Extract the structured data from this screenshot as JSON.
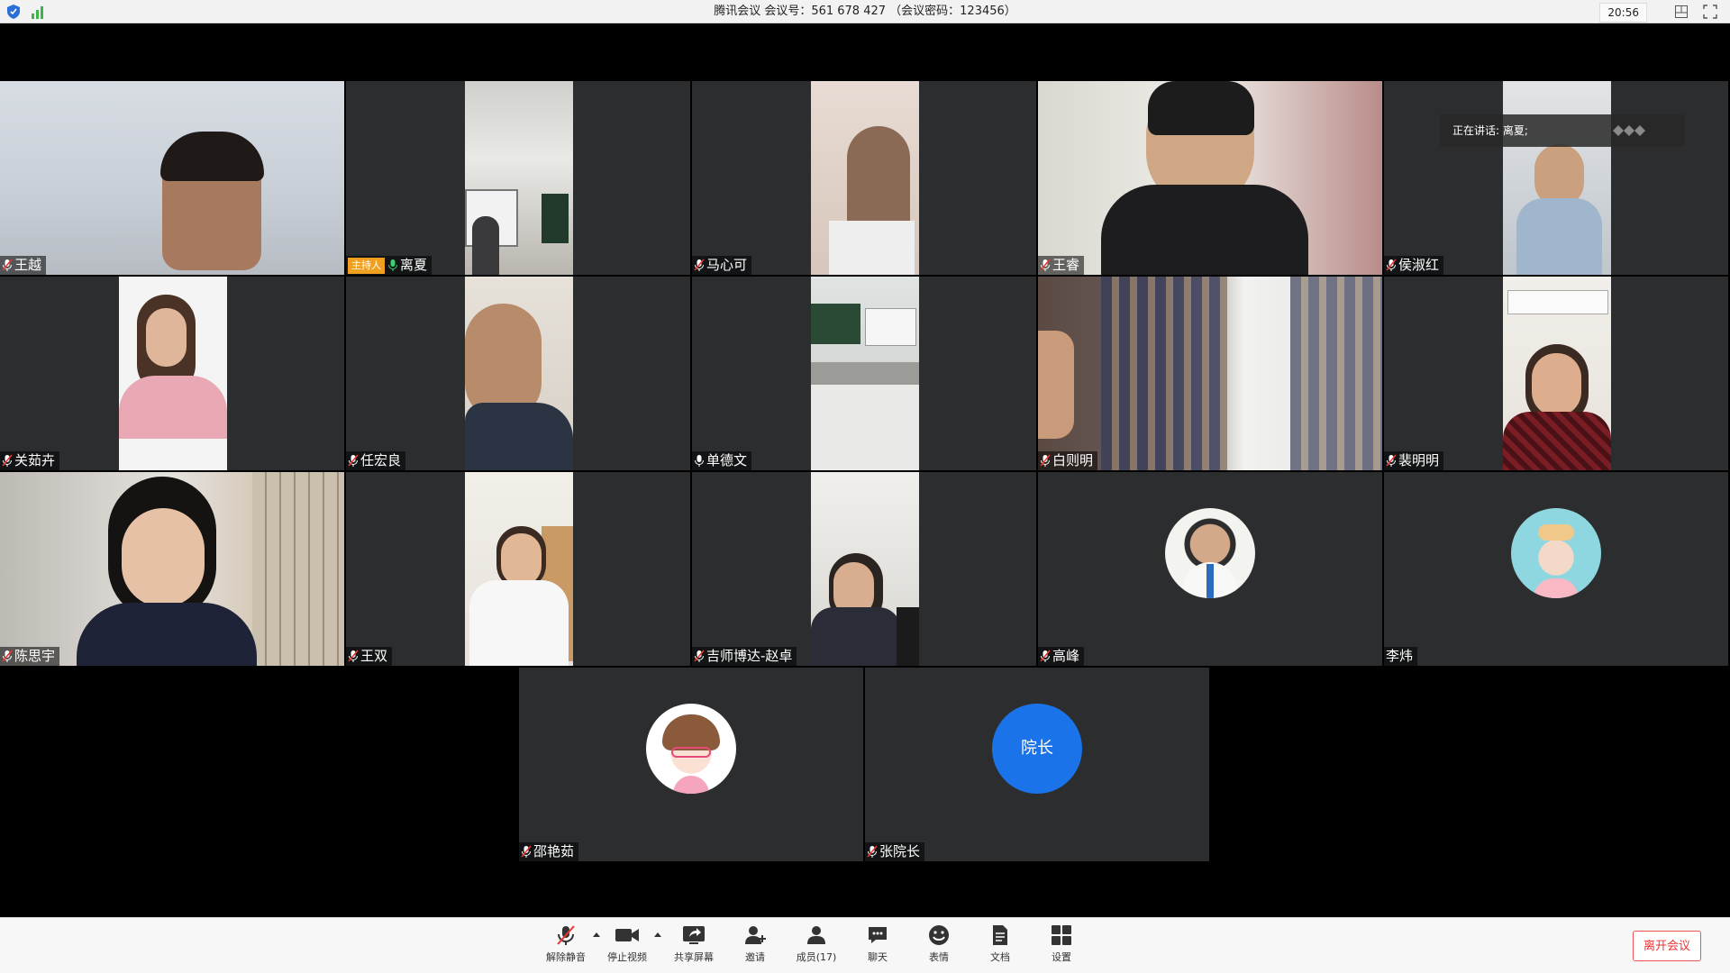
{
  "window": {
    "title": "腾讯会议 会议号：561 678 427 （会议密码：123456）",
    "clock": "20:56"
  },
  "speaking_indicator": "正在讲话: 离夏;",
  "participants": [
    {
      "name": "王越"
    },
    {
      "name": "离夏",
      "badge": "主持人"
    },
    {
      "name": "马心可"
    },
    {
      "name": "王睿"
    },
    {
      "name": "侯淑红"
    },
    {
      "name": "关茹卉"
    },
    {
      "name": "任宏良"
    },
    {
      "name": "单德文"
    },
    {
      "name": "白则明"
    },
    {
      "name": "裴明明"
    },
    {
      "name": "陈思宇"
    },
    {
      "name": "王双"
    },
    {
      "name": "吉师博达-赵卓"
    },
    {
      "name": "高峰"
    },
    {
      "name": "李炜"
    },
    {
      "name": "邵艳茹"
    },
    {
      "name": "张院长",
      "avatar_text": "院长"
    }
  ],
  "toolbar": {
    "unmute": "解除静音",
    "stop_video": "停止视频",
    "share_screen": "共享屏幕",
    "invite": "邀请",
    "members": "成员(17)",
    "chat": "聊天",
    "reactions": "表情",
    "docs": "文档",
    "settings": "设置",
    "leave": "离开会议"
  },
  "colors": {
    "tile_bg": "#2c2d2f",
    "accent_blue": "#1a73e8",
    "host_badge": "#f0a020",
    "leave_red": "#e33333"
  }
}
